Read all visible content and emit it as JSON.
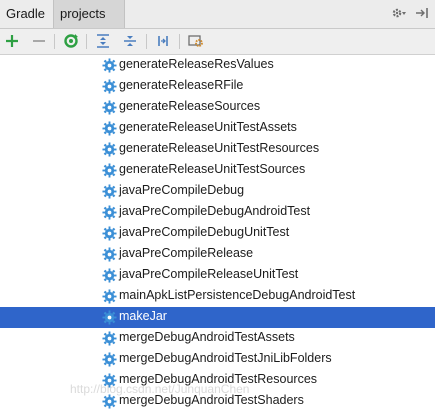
{
  "tabs": {
    "gradle": "Gradle",
    "projects": "projects"
  },
  "tab_icons": [
    "gear-icon",
    "collapse-panel-icon"
  ],
  "toolbar": {
    "buttons": [
      "add-icon",
      "remove-icon",
      "refresh-icon",
      "expand-all-icon",
      "collapse-all-icon",
      "link-icon",
      "settings-icon"
    ]
  },
  "tasks": [
    "generateReleaseResValues",
    "generateReleaseRFile",
    "generateReleaseSources",
    "generateReleaseUnitTestAssets",
    "generateReleaseUnitTestResources",
    "generateReleaseUnitTestSources",
    "javaPreCompileDebug",
    "javaPreCompileDebugAndroidTest",
    "javaPreCompileDebugUnitTest",
    "javaPreCompileRelease",
    "javaPreCompileReleaseUnitTest",
    "mainApkListPersistenceDebugAndroidTest",
    "makeJar",
    "mergeDebugAndroidTestAssets",
    "mergeDebugAndroidTestJniLibFolders",
    "mergeDebugAndroidTestResources",
    "mergeDebugAndroidTestShaders"
  ],
  "selected_task": "makeJar",
  "watermark": "http://blog.csdn.net/JunquanChen",
  "colors": {
    "selection": "#2f65ca",
    "gear": "#3b8fd6",
    "add": "#2ea043",
    "refresh": "#2ea043"
  }
}
